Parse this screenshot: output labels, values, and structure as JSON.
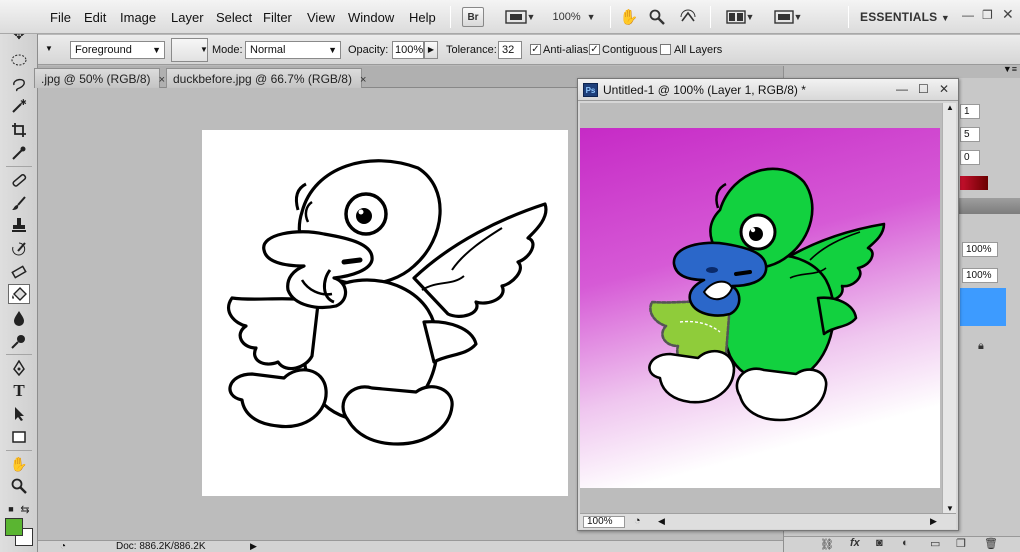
{
  "app": {
    "menus": [
      "File",
      "Edit",
      "Image",
      "Layer",
      "Select",
      "Filter",
      "View",
      "Window",
      "Help"
    ],
    "bridge_label": "Br",
    "zoom_select": "100%",
    "workspace": "ESSENTIALS"
  },
  "options": {
    "fill_source": "Foreground",
    "mode_label": "Mode:",
    "mode_value": "Normal",
    "opacity_label": "Opacity:",
    "opacity_value": "100%",
    "tolerance_label": "Tolerance:",
    "tolerance_value": "32",
    "antialias_label": "Anti-alias",
    "antialias_checked": true,
    "contiguous_label": "Contiguous",
    "contiguous_checked": true,
    "all_layers_label": "All Layers",
    "all_layers_checked": false
  },
  "tabs": [
    {
      "label": ".jpg @ 50% (RGB/8)",
      "close": "×"
    },
    {
      "label": "duckbefore.jpg @ 66.7% (RGB/8)",
      "close": "×"
    }
  ],
  "floating_window": {
    "icon_label": "Ps",
    "title": "Untitled-1 @ 100% (Layer 1, RGB/8) *",
    "zoom": "100%"
  },
  "status": {
    "doc_size": "Doc: 886.2K/886.2K"
  },
  "right_panel": {
    "field_a": "1",
    "field_b": "5",
    "field_c": "0",
    "opacity_1": "100%",
    "opacity_2": "100%"
  },
  "colors": {
    "foreground": "#5ab531",
    "background": "#ffffff",
    "duck_green": "#12d13f",
    "duck_blue": "#2b67c9",
    "wing_lime": "#8fcc3a",
    "magenta": "#c62ac6",
    "selected_layer": "#3d9bff"
  },
  "tools": [
    "move-icon",
    "marquee-icon",
    "lasso-icon",
    "magic-wand-icon",
    "crop-icon",
    "eyedropper-icon",
    "healing-brush-icon",
    "brush-icon",
    "clone-stamp-icon",
    "history-brush-icon",
    "eraser-icon",
    "paint-bucket-icon",
    "blur-icon",
    "dodge-icon",
    "pen-icon",
    "type-icon",
    "path-select-icon",
    "shape-icon",
    "hand-icon",
    "zoom-icon"
  ]
}
